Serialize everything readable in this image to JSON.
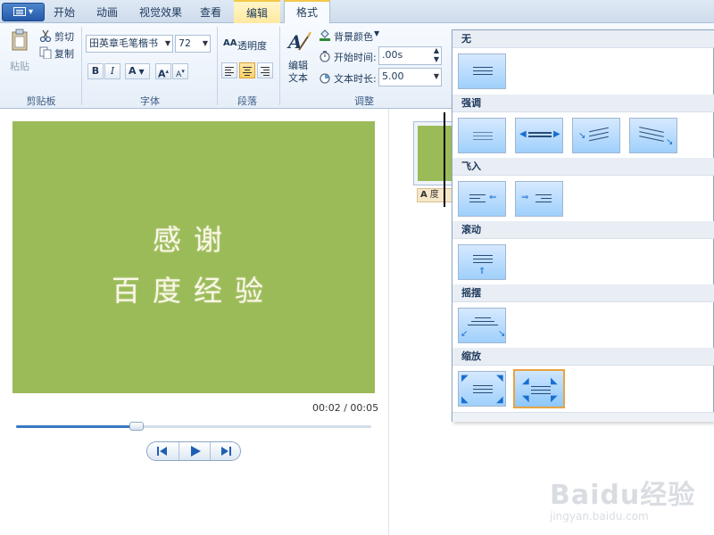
{
  "tabs": [
    {
      "label": "开始"
    },
    {
      "label": "动画"
    },
    {
      "label": "视觉效果"
    },
    {
      "label": "查看"
    },
    {
      "label": "编辑"
    },
    {
      "label": "格式"
    }
  ],
  "clipboard": {
    "paste": "粘贴",
    "cut": "剪切",
    "copy": "复制",
    "group": "剪贴板"
  },
  "font": {
    "family": "田英章毛笔楷书",
    "size": "72",
    "bold": "B",
    "italic": "I",
    "color_a": "A",
    "grow": "A",
    "shrink": "A",
    "group": "字体"
  },
  "paragraph": {
    "transparency": "透明度",
    "group": "段落"
  },
  "adjust": {
    "edit_text_line1": "编辑",
    "edit_text_line2": "文本",
    "bg_color": "背景颜色",
    "start_time_label": "开始时间:",
    "start_time_value": ".00s",
    "duration_label": "文本时长:",
    "duration_value": "5.00",
    "group": "调整"
  },
  "preview": {
    "line1": "感谢",
    "line2": "百度经验",
    "bg_color": "#9bbb59"
  },
  "player": {
    "time": "00:02 / 00:05",
    "progress_pct": 34
  },
  "storyboard": {
    "caption_icon": "A",
    "caption_text": "度"
  },
  "effects": {
    "sections": [
      {
        "title": "无"
      },
      {
        "title": "强调"
      },
      {
        "title": "飞入"
      },
      {
        "title": "滚动"
      },
      {
        "title": "摇摆"
      },
      {
        "title": "缩放"
      }
    ]
  },
  "watermark": {
    "brand": "Baidu经验",
    "url": "jingyan.baidu.com"
  },
  "accent_color": "#2459a8"
}
